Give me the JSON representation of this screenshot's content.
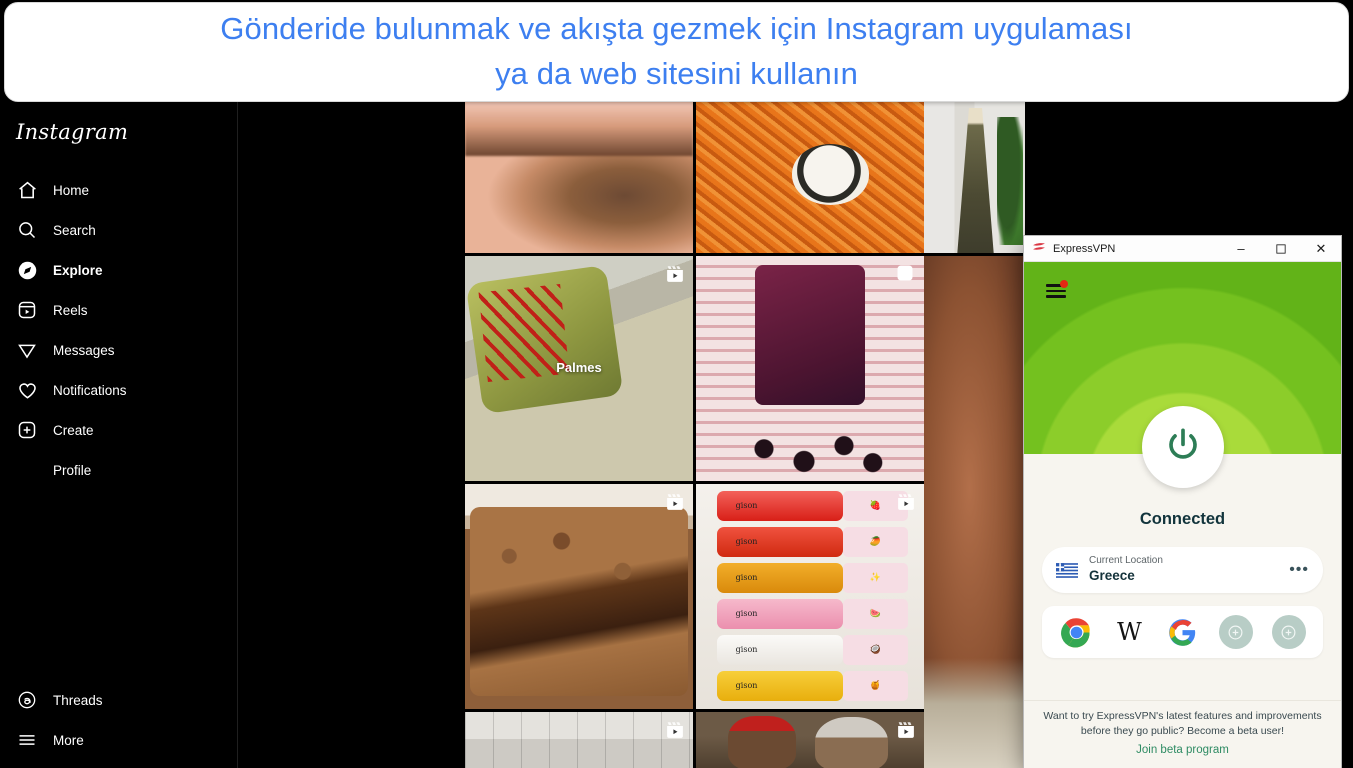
{
  "banner": {
    "line1": "Gönderide bulunmak ve akışta gezmek için Instagram uygulaması",
    "line2": "ya da web sitesini kullanın",
    "text_color": "#3d7ff0",
    "background": "#ffffff"
  },
  "instagram": {
    "logo": "Instagram",
    "nav": [
      {
        "label": "Home",
        "icon": "home-icon",
        "active": false
      },
      {
        "label": "Search",
        "icon": "search-icon",
        "active": false
      },
      {
        "label": "Explore",
        "icon": "compass-icon",
        "active": true
      },
      {
        "label": "Reels",
        "icon": "reels-icon",
        "active": false
      },
      {
        "label": "Messages",
        "icon": "paper-plane-icon",
        "active": false
      },
      {
        "label": "Notifications",
        "icon": "heart-icon",
        "active": false
      },
      {
        "label": "Create",
        "icon": "plus-square-icon",
        "active": false
      },
      {
        "label": "Profile",
        "icon": "avatar-icon",
        "active": false
      }
    ],
    "nav_bottom": [
      {
        "label": "Threads",
        "icon": "threads-icon"
      },
      {
        "label": "More",
        "icon": "hamburger-icon"
      }
    ],
    "grid": {
      "rows": [
        [
          {
            "alt": "blurred-skin-closeup",
            "badge": ""
          },
          {
            "alt": "spicy-ramen-noodles-with-kimbap",
            "badge": ""
          },
          {
            "alt": "woman-in-floral-gown",
            "badge": ""
          }
        ],
        [
          {
            "alt": "tamale-tied-with-red-string",
            "badge": "reel-icon",
            "caption": "Palmes"
          },
          {
            "alt": "chocolate-covered-cherries-pouch",
            "badge": "carousel-icon"
          },
          {
            "alt": "skin-closeup",
            "badge": ""
          }
        ],
        [
          {
            "alt": "chocolate-crumb-cake",
            "badge": "reel-icon"
          },
          {
            "alt": "gison-lip-gloss-lineup",
            "badge": "reel-icon"
          },
          {
            "alt": "skin-closeup-continued",
            "badge": ""
          }
        ],
        [
          {
            "alt": "tiled-wall-interior",
            "badge": "reel-icon"
          },
          {
            "alt": "two-women-in-kitchen",
            "badge": "reel-icon"
          },
          {
            "alt": "skin-closeup-bottom",
            "badge": ""
          }
        ]
      ],
      "gloss_labels": [
        "gison",
        "gison",
        "gison",
        "gison",
        "gison",
        "gison"
      ],
      "gloss_emojis": [
        "🍓",
        "🥭",
        "✨",
        "🍉",
        "🥥",
        "🍯"
      ]
    }
  },
  "vpn": {
    "title": "ExpressVPN",
    "logo_color": "#da3743",
    "window_buttons": {
      "minimize": "–",
      "maximize": "▢",
      "close": "✕"
    },
    "menu": {
      "name": "hamburger-menu",
      "has_notification_dot": true,
      "dot_color": "#e52713"
    },
    "status": "Connected",
    "power_button": "power-icon",
    "hero_color": "#74c11f",
    "location": {
      "label": "Current Location",
      "value": "Greece",
      "flag": "greece-flag",
      "more": "•••"
    },
    "shortcuts": [
      {
        "name": "chrome-shortcut",
        "label": "Chrome"
      },
      {
        "name": "wikipedia-shortcut",
        "label": "W"
      },
      {
        "name": "google-shortcut",
        "label": "G"
      },
      {
        "name": "add-shortcut-1",
        "label": "+"
      },
      {
        "name": "add-shortcut-2",
        "label": "+"
      }
    ],
    "beta": {
      "text": "Want to try ExpressVPN's latest features and improvements before they go public? Become a beta user!",
      "link": "Join beta program",
      "link_color": "#2e8b63"
    }
  }
}
